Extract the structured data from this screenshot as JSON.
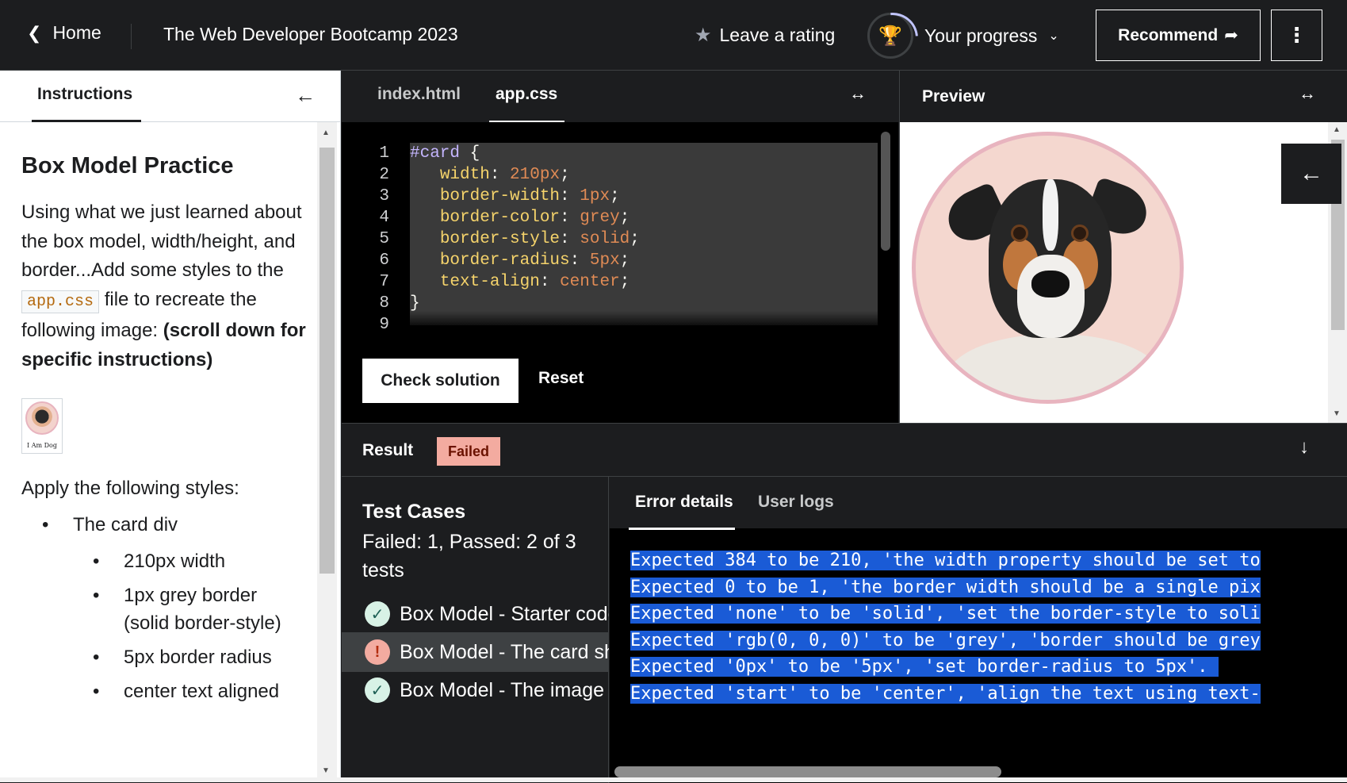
{
  "topbar": {
    "home_label": "Home",
    "course_title": "The Web Developer Bootcamp 2023",
    "rating_label": "Leave a rating",
    "progress_label": "Your progress",
    "recommend_label": "Recommend",
    "kebab": "⋮"
  },
  "instructions": {
    "tab_label": "Instructions",
    "heading": "Box Model Practice",
    "intro_before": "Using what we just learned about the box model, width/height, and border...Add some styles to the",
    "intro_code": "app.css",
    "intro_after": "file to recreate the following image:",
    "intro_bold": "(scroll down for specific instructions)",
    "thumb_caption": "I Am Dog",
    "apply_label": "Apply the following styles:",
    "list_top": "The card div",
    "list_items": [
      "210px width",
      "1px grey border (solid border-style)",
      "5px border radius",
      "center text aligned"
    ]
  },
  "editor": {
    "tabs": [
      "index.html",
      "app.css"
    ],
    "active_tab": "app.css",
    "line_numbers": [
      "1",
      "2",
      "3",
      "4",
      "5",
      "6",
      "7",
      "8",
      "9"
    ],
    "code": {
      "selector": "#card",
      "open_brace": "{",
      "close_brace": "}",
      "props": [
        {
          "prop": "width",
          "value": "210px"
        },
        {
          "prop": "border-width",
          "value": "1px"
        },
        {
          "prop": "border-color",
          "value": "grey"
        },
        {
          "prop": "border-style",
          "value": "solid"
        },
        {
          "prop": "border-radius",
          "value": "5px"
        },
        {
          "prop": "text-align",
          "value": "center"
        }
      ]
    },
    "check_label": "Check solution",
    "reset_label": "Reset",
    "expand_icon": "↔"
  },
  "preview": {
    "title": "Preview",
    "expand_icon": "↔"
  },
  "result": {
    "title": "Result",
    "status": "Failed",
    "tests_title": "Test Cases",
    "tests_summary": "Failed: 1, Passed: 2 of 3 tests",
    "cases": [
      {
        "label": "Box Model - Starter code",
        "status": "passed"
      },
      {
        "label": "Box Model - The card should",
        "status": "failed"
      },
      {
        "label": "Box Model - The image",
        "status": "passed"
      }
    ],
    "error_tabs": [
      "Error details",
      "User logs"
    ],
    "errors": [
      "Expected 384 to be 210, 'the width property should be set to",
      "Expected 0 to be 1, 'the border width should be a single pix",
      "Expected 'none' to be 'solid', 'set the border-style to soli",
      "Expected 'rgb(0, 0, 0)' to be 'grey', 'border should be grey",
      "Expected '0px' to be '5px', 'set border-radius to 5px'. ",
      "Expected 'start' to be 'center', 'align the text using text-"
    ]
  },
  "colors": {
    "background": "#1c1d1f",
    "failed_badge": "#f3aba0",
    "selection": "#1a5bd6",
    "pink_border": "#e8b4bf"
  }
}
